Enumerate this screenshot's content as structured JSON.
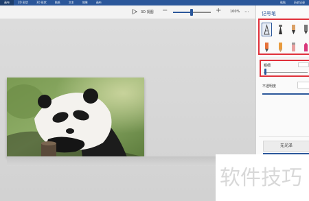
{
  "menubar": {
    "tabs": [
      {
        "label": "画布"
      },
      {
        "label": "2D 形状"
      },
      {
        "label": "3D 形状"
      },
      {
        "label": "贴纸"
      },
      {
        "label": "文本"
      },
      {
        "label": "效果"
      },
      {
        "label": "画布"
      }
    ],
    "right_items": [
      {
        "label": "粘贴"
      },
      {
        "label": "历史记录"
      }
    ]
  },
  "toolbar": {
    "view_3d_label": "3D 视图",
    "zoom_level": "100%",
    "zoom_fraction": 0.45
  },
  "panel": {
    "title": "记号笔",
    "pens": [
      {
        "name": "marker",
        "color": "#444444",
        "selected": true
      },
      {
        "name": "calligraphy-pen",
        "color": "#2e2e2e"
      },
      {
        "name": "oil-brush",
        "color": "#d9a066"
      },
      {
        "name": "watercolor",
        "color": "#4a4a4a"
      },
      {
        "name": "pixel-pen",
        "color": "#e7723a"
      },
      {
        "name": "pencil",
        "color": "#e89b3e"
      },
      {
        "name": "eraser",
        "color": "#e8a0a0"
      },
      {
        "name": "crayon",
        "color": "#d8377a"
      },
      {
        "name": "spray-can",
        "color": "#e0702c"
      }
    ],
    "thickness_label": "粗细",
    "thickness_value_fraction": 0.05,
    "opacity_label": "不透明度",
    "no_fill_button": "无光泽"
  },
  "watermark": {
    "text": "软件技巧"
  },
  "colors": {
    "accent": "#2b579a",
    "highlight_box": "#e0303a"
  }
}
